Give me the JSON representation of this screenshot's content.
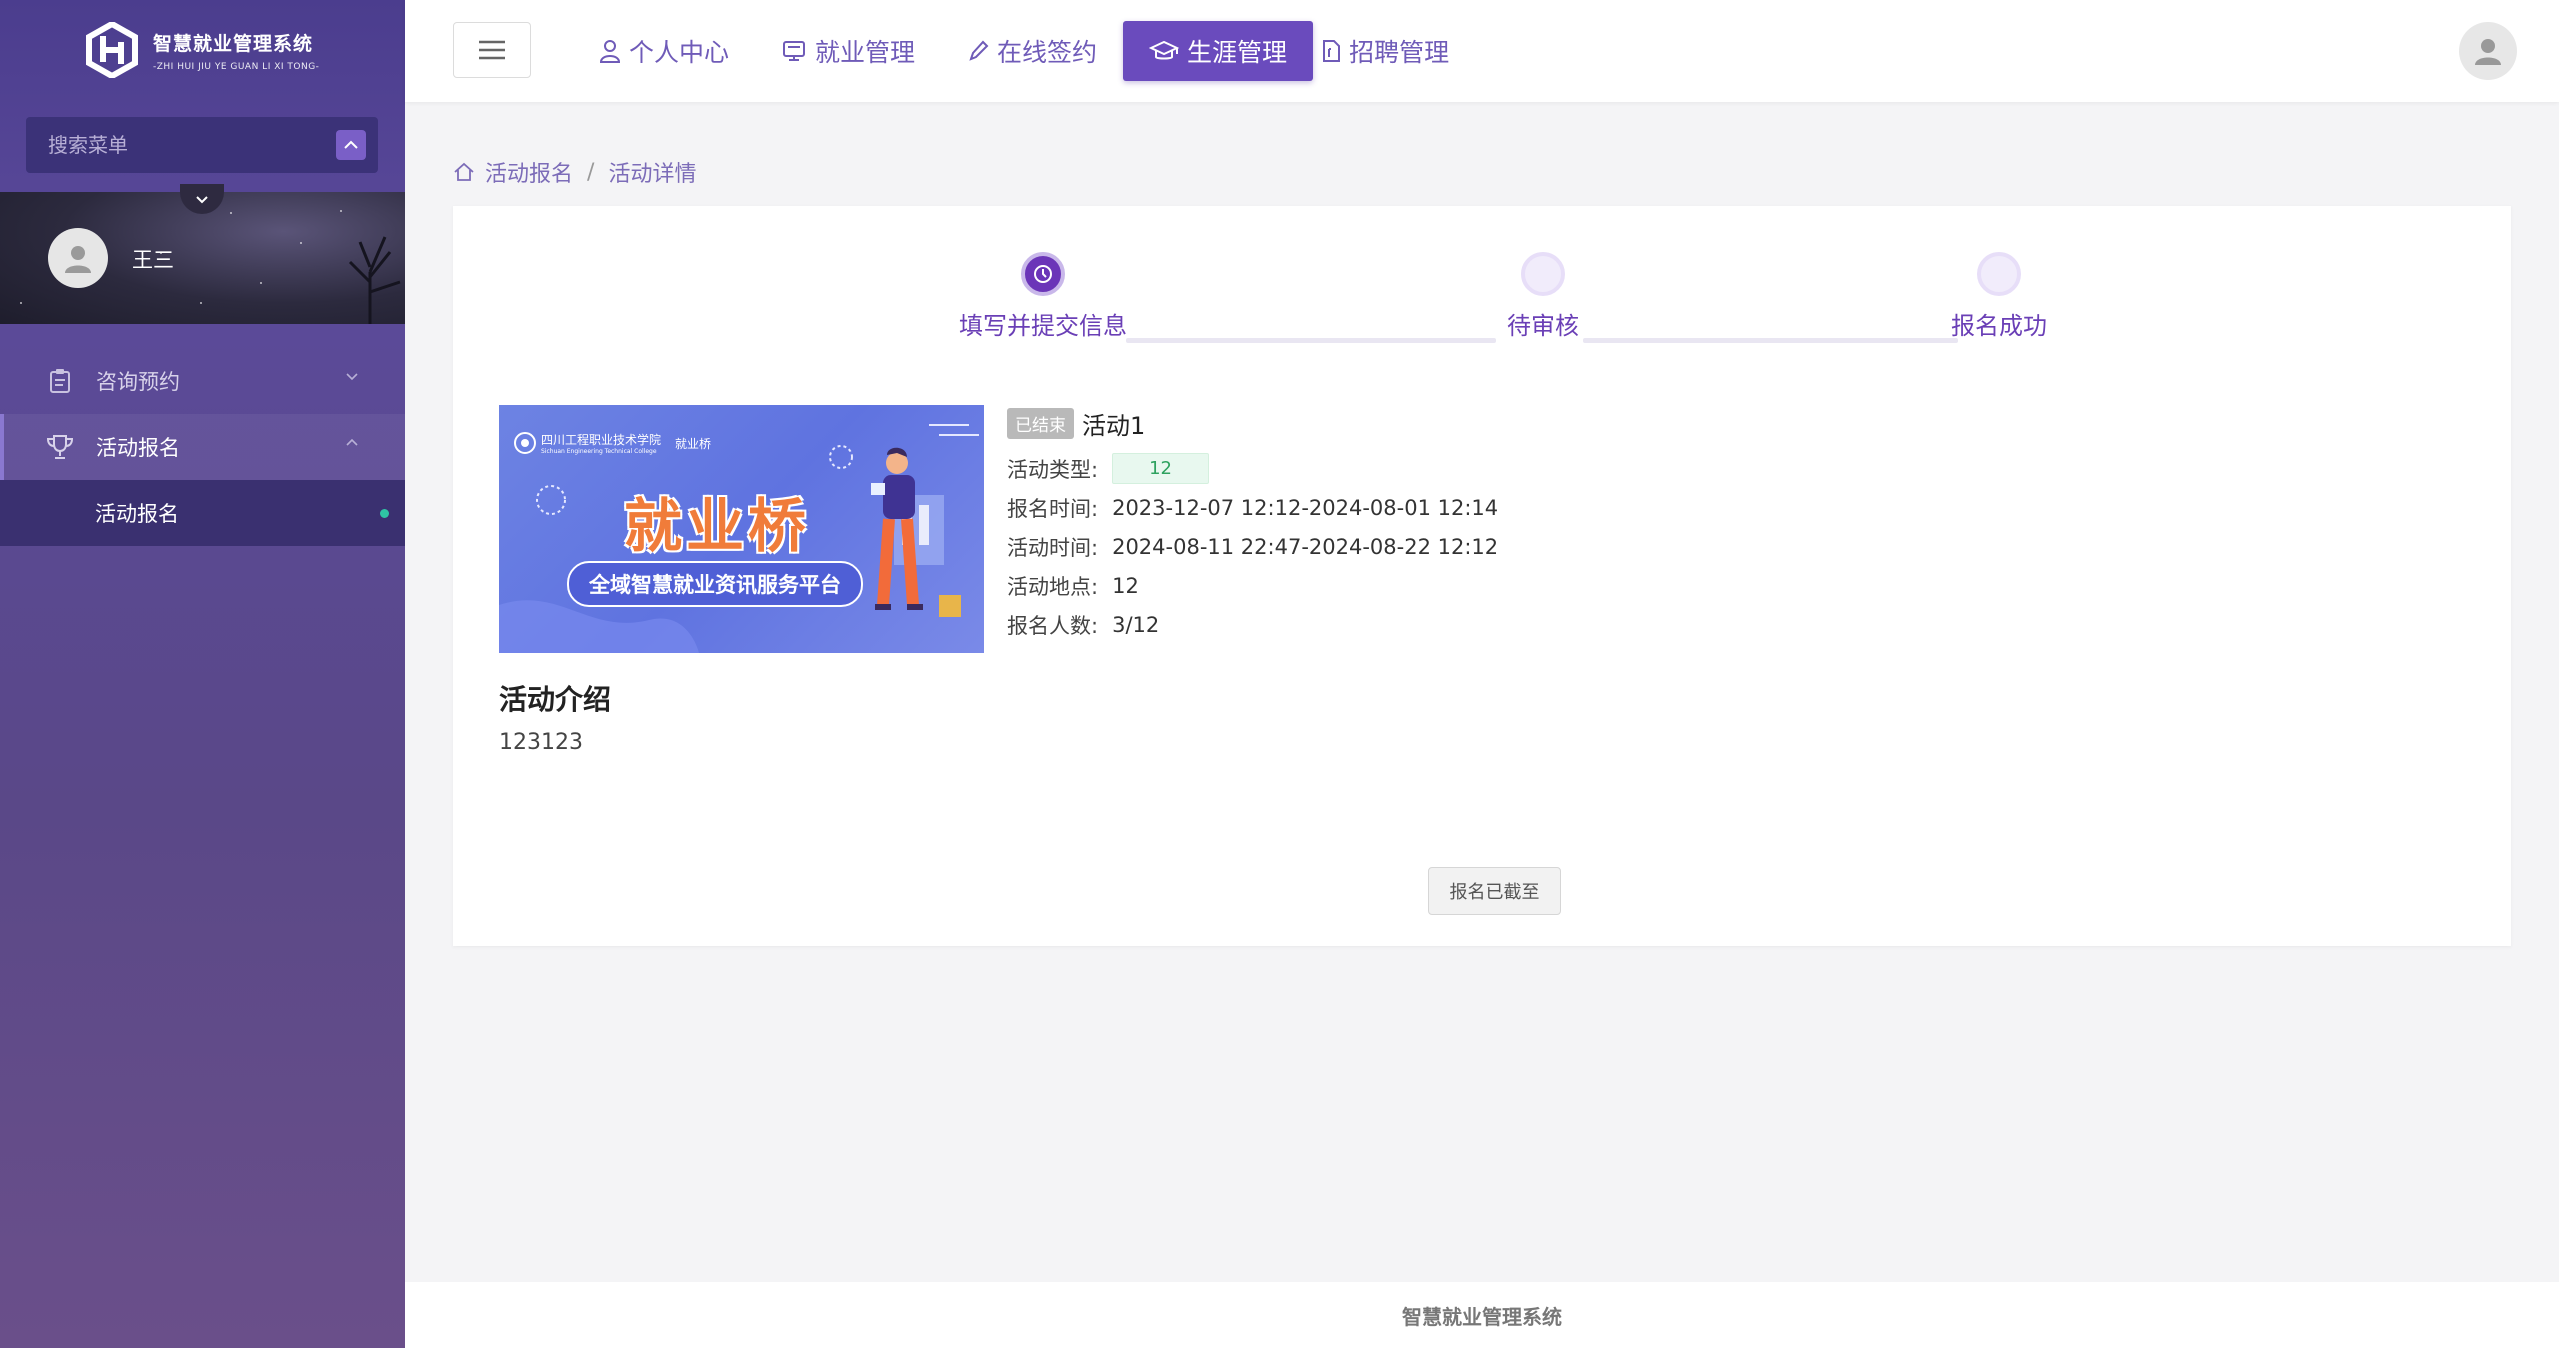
{
  "brand": {
    "name": "智慧就业管理系统",
    "subtitle": "-ZHI HUI JIU YE GUAN LI XI TONG-"
  },
  "sidebar": {
    "search_placeholder": "搜索菜单",
    "user_name": "王三",
    "items": [
      {
        "label": "咨询预约",
        "icon": "clipboard-icon",
        "expanded": false
      },
      {
        "label": "活动报名",
        "icon": "trophy-icon",
        "expanded": true
      }
    ],
    "sub_items": [
      {
        "label": "活动报名",
        "active": true
      }
    ]
  },
  "topnav": {
    "items": [
      {
        "label": "个人中心",
        "icon": "user-icon",
        "active": false
      },
      {
        "label": "就业管理",
        "icon": "briefcase-icon",
        "active": false
      },
      {
        "label": "在线签约",
        "icon": "pen-icon",
        "active": false
      },
      {
        "label": "生涯管理",
        "icon": "graduation-cap-icon",
        "active": true
      },
      {
        "label": "招聘管理",
        "icon": "document-icon",
        "active": false
      }
    ]
  },
  "breadcrumb": {
    "home": "活动报名",
    "current": "活动详情",
    "separator": "/"
  },
  "steps": [
    {
      "label": "填写并提交信息",
      "state": "done"
    },
    {
      "label": "待审核",
      "state": "todo"
    },
    {
      "label": "报名成功",
      "state": "todo"
    }
  ],
  "banner": {
    "school": "四川工程职业技术学院",
    "school_en": "Sichuan Engineering Technical College",
    "brand": "就业桥",
    "title": "就业桥",
    "subtitle": "全域智慧就业资讯服务平台"
  },
  "activity": {
    "status": "已结束",
    "name": "活动1",
    "type_label": "活动类型:",
    "type_value": "12",
    "signup_time_label": "报名时间:",
    "signup_time": "2023-12-07 12:12-2024-08-01 12:14",
    "event_time_label": "活动时间:",
    "event_time": "2024-08-11 22:47-2024-08-22 12:12",
    "location_label": "活动地点:",
    "location": "12",
    "count_label": "报名人数:",
    "count": "3/12",
    "intro_title": "活动介绍",
    "intro_text": "123123",
    "closed_button": "报名已截至"
  },
  "footer": {
    "text": "智慧就业管理系统"
  },
  "colors": {
    "primary": "#6a4bbd",
    "sidebar": "#4b3d8e",
    "success": "#2ea25f"
  }
}
